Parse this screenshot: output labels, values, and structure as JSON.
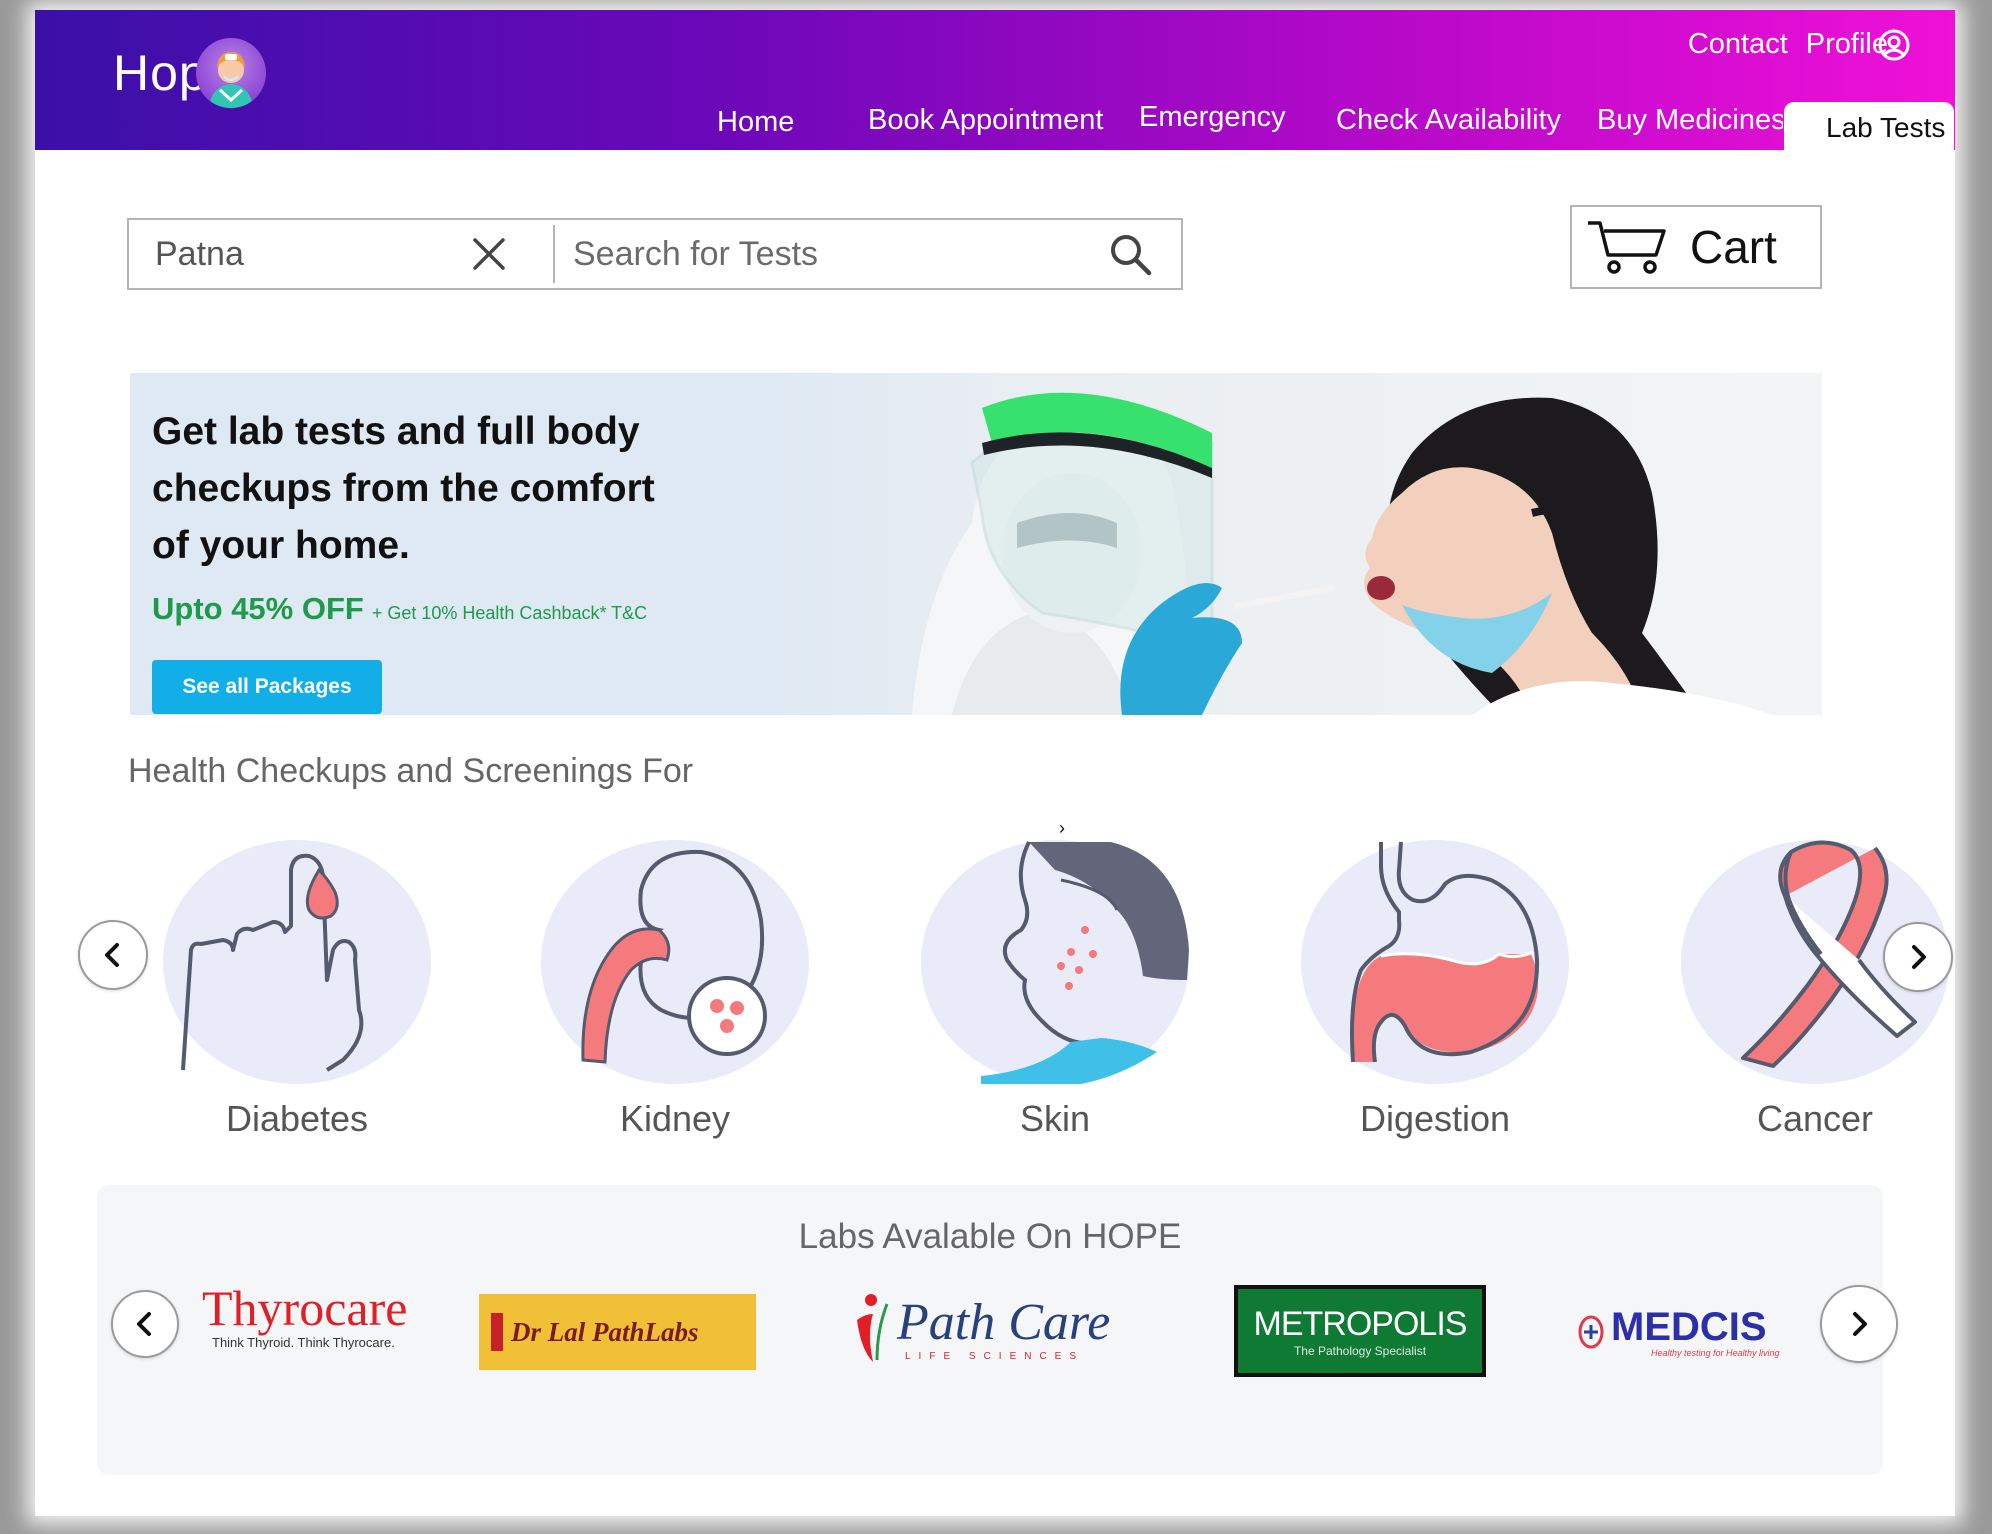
{
  "header": {
    "brand": "Hop",
    "top_links": {
      "contact": "Contact",
      "profile": "Profile"
    },
    "nav": [
      {
        "label": "Home"
      },
      {
        "label": "Book Appointment"
      },
      {
        "label": "Emergency"
      },
      {
        "label": "Check Availability"
      },
      {
        "label": "Buy Medicines"
      },
      {
        "label": "Lab Tests",
        "active": true
      }
    ]
  },
  "search": {
    "location": "Patna",
    "placeholder": "Search for Tests"
  },
  "cart": {
    "label": "Cart"
  },
  "banner": {
    "line1": "Get lab tests and full body",
    "line2": "checkups from the comfort",
    "line3": "of your home.",
    "offer": "Upto 45% OFF",
    "offer_sub": "+ Get 10% Health Cashback* T&C",
    "button": "See all Packages"
  },
  "categories": {
    "title": "Health Checkups and Screenings For",
    "items": [
      {
        "label": "Diabetes",
        "icon": "finger-blood-drop-icon"
      },
      {
        "label": "Kidney",
        "icon": "kidney-icon"
      },
      {
        "label": "Skin",
        "icon": "skin-face-icon"
      },
      {
        "label": "Digestion",
        "icon": "stomach-icon"
      },
      {
        "label": "Cancer",
        "icon": "cancer-ribbon-icon"
      }
    ]
  },
  "labs": {
    "title": "Labs Avalable On HOPE",
    "items": [
      {
        "name": "Thyrocare",
        "tagline": "Think Thyroid. Think Thyrocare."
      },
      {
        "name": "Dr Lal PathLabs"
      },
      {
        "name": "Path Care",
        "tagline": "LIFE SCIENCES"
      },
      {
        "name": "METROPOLIS",
        "tagline": "The Pathology Specialist"
      },
      {
        "name": "MEDCIS",
        "tagline": "Healthy testing for Healthy living"
      }
    ]
  },
  "colors": {
    "header_start": "#3a10a8",
    "header_end": "#f010d8",
    "offer_green": "#1d9b4b",
    "button_blue": "#11aee8",
    "category_circle": "#e9ebf8",
    "illustration_pink": "#f47a7e",
    "illustration_dark": "#555a6e",
    "illustration_blue": "#3fc0e8"
  }
}
